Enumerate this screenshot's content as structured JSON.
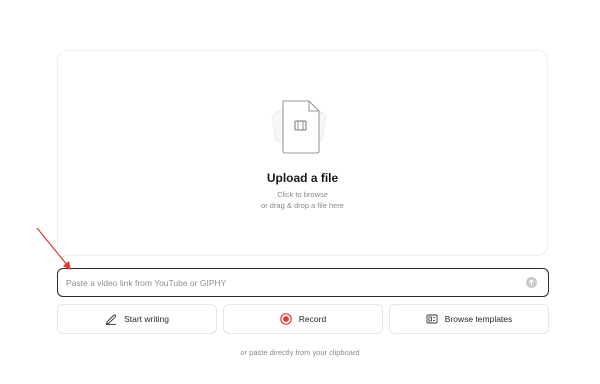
{
  "upload": {
    "title": "Upload a file",
    "line1": "Click to browse",
    "line2": "or drag & drop a file here"
  },
  "link_input": {
    "placeholder": "Paste a video link from YouTube or GIPHY",
    "value": ""
  },
  "actions": {
    "write_label": "Start writing",
    "record_label": "Record",
    "templates_label": "Browse templates"
  },
  "clipboard_hint": "or paste directly from your clipboard",
  "icons": {
    "write": "pen-icon",
    "record": "record-icon",
    "templates": "template-icon",
    "submit": "submit-icon",
    "file": "video-file-icon"
  },
  "colors": {
    "record_red": "#e53935",
    "annotation_red": "#e0382c",
    "input_border": "#2b2b2b"
  }
}
